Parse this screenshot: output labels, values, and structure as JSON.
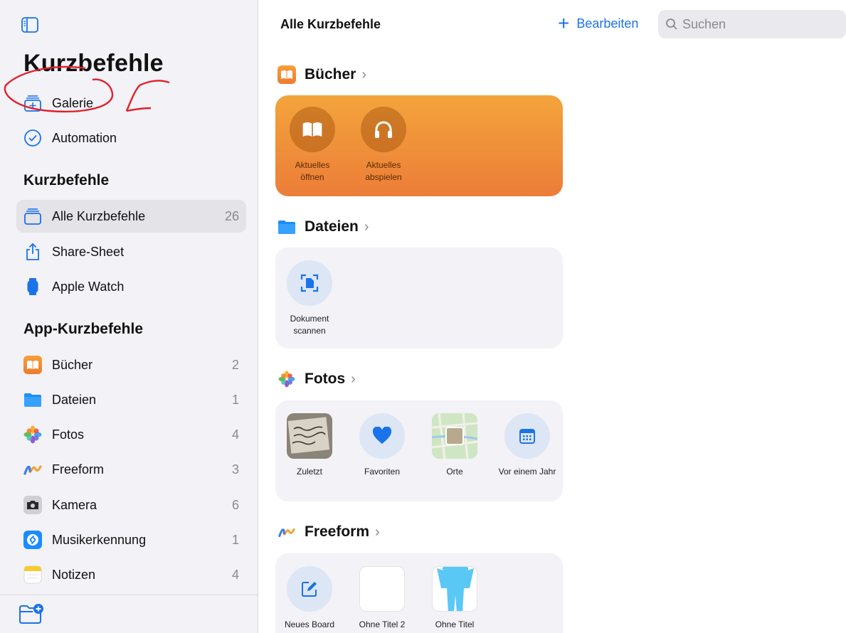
{
  "sidebar": {
    "title": "Kurzbefehle",
    "top_items": [
      {
        "label": "Galerie",
        "icon": "gallery-icon"
      },
      {
        "label": "Automation",
        "icon": "automation-clock-icon"
      }
    ],
    "section1": "Kurzbefehle",
    "shortcut_items": [
      {
        "label": "Alle Kurzbefehle",
        "count": "26",
        "icon": "stack-icon",
        "selected": true
      },
      {
        "label": "Share-Sheet",
        "count": "",
        "icon": "share-icon"
      },
      {
        "label": "Apple Watch",
        "count": "",
        "icon": "watch-icon"
      }
    ],
    "section2": "App-Kurzbefehle",
    "app_items": [
      {
        "label": "Bücher",
        "count": "2",
        "icon": "books-icon"
      },
      {
        "label": "Dateien",
        "count": "1",
        "icon": "files-icon"
      },
      {
        "label": "Fotos",
        "count": "4",
        "icon": "photos-icon"
      },
      {
        "label": "Freeform",
        "count": "3",
        "icon": "freeform-icon"
      },
      {
        "label": "Kamera",
        "count": "6",
        "icon": "camera-icon"
      },
      {
        "label": "Musikerkennung",
        "count": "1",
        "icon": "shazam-icon"
      },
      {
        "label": "Notizen",
        "count": "4",
        "icon": "notes-icon"
      }
    ]
  },
  "header": {
    "title": "Alle Kurzbefehle",
    "edit_label": "Bearbeiten",
    "search_placeholder": "Suchen"
  },
  "sections": {
    "books": {
      "title": "Bücher",
      "tiles": [
        "Aktuelles öffnen",
        "Aktuelles abspielen"
      ]
    },
    "files": {
      "title": "Dateien",
      "tiles": [
        "Dokument scannen"
      ]
    },
    "photos": {
      "title": "Fotos",
      "tiles": [
        "Zuletzt",
        "Favoriten",
        "Orte",
        "Vor einem Jahr"
      ]
    },
    "freeform": {
      "title": "Freeform",
      "tiles": [
        "Neues Board",
        "Ohne Titel 2",
        "Ohne Titel"
      ]
    }
  },
  "colors": {
    "accent": "#1a73e8",
    "books_orange": "#f08a38",
    "sidebar_bg": "#f2f2f7",
    "annotation_red": "#e0202a"
  }
}
